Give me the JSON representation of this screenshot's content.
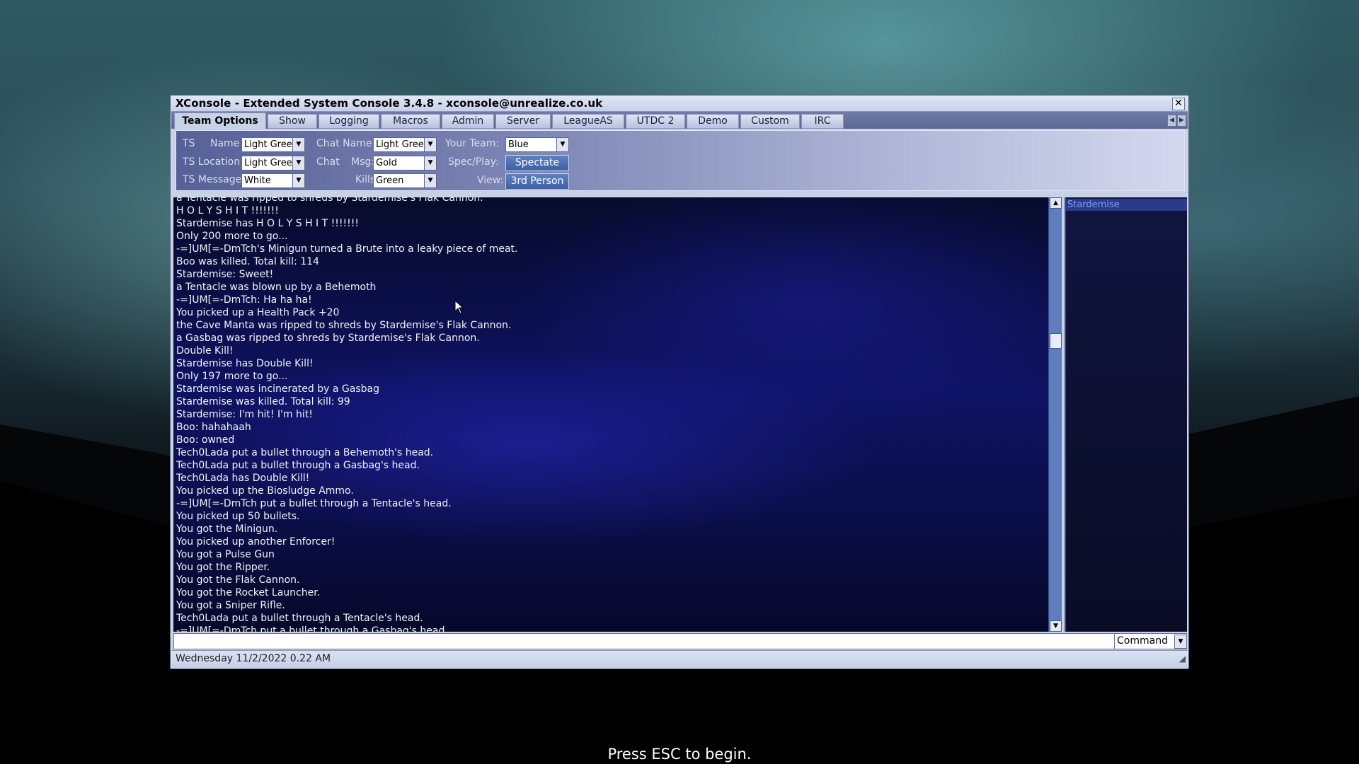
{
  "window": {
    "title": "XConsole - Extended System Console 3.4.8 - xconsole@unrealize.co.uk",
    "close_glyph": "✕"
  },
  "tabs": [
    {
      "label": "Team Options",
      "active": true
    },
    {
      "label": "Show"
    },
    {
      "label": "Logging"
    },
    {
      "label": "Macros"
    },
    {
      "label": "Admin"
    },
    {
      "label": "Server"
    },
    {
      "label": "LeagueAS"
    },
    {
      "label": "UTDC 2"
    },
    {
      "label": "Demo"
    },
    {
      "label": "Custom"
    },
    {
      "label": "IRC"
    }
  ],
  "options": {
    "ts_label": "TS",
    "name_label": "Name",
    "name_value": "Light Green",
    "ts_location_label": "TS Location:",
    "ts_location_value": "Light Green",
    "ts_message_label": "TS Message:",
    "ts_message_value": "White",
    "chat_name_label": "Chat Name:",
    "chat_name_value": "Light Green",
    "chat_label": "Chat",
    "msg_label": "Msg:",
    "msg_value": "Gold",
    "kills_label": "Kills",
    "kills_value": "Green",
    "your_team_label": "Your Team:",
    "your_team_value": "Blue",
    "spec_play_label": "Spec/Play:",
    "spectate_button": "Spectate",
    "view_label": "View:",
    "view_button": "3rd Person"
  },
  "log": {
    "partial_top": "a Tentacle was ripped to shreds by Stardemise's Flak Cannon.",
    "lines": [
      "H O L Y   S H I T !!!!!!!",
      "Stardemise has H O L Y   S H I T !!!!!!!",
      "Only 200 more to go...",
      "-=]UM[=-DmTch's Minigun turned a Brute into a leaky piece of meat.",
      "Boo was killed. Total kill:  114",
      "Stardemise: Sweet!",
      "a Tentacle was blown up by a Behemoth",
      "-=]UM[=-DmTch: Ha ha ha!",
      "You picked up a Health Pack +20",
      "the Cave Manta was ripped to shreds by Stardemise's Flak Cannon.",
      "a Gasbag was ripped to shreds by Stardemise's Flak Cannon.",
      "Double Kill!",
      "Stardemise has Double Kill!",
      "Only 197 more to go...",
      "Stardemise was incinerated by a Gasbag",
      "Stardemise was killed. Total kill:  99",
      "Stardemise: I'm hit! I'm hit!",
      "Boo: hahahaah",
      "Boo: owned",
      "Tech0Lada put a bullet through a Behemoth's head.",
      "Tech0Lada put a bullet through a Gasbag's head.",
      "Tech0Lada has Double Kill!",
      "You picked up the Biosludge Ammo.",
      "-=]UM[=-DmTch put a bullet through a Tentacle's head.",
      "You picked up 50 bullets.",
      "You got the Minigun.",
      "You picked up another Enforcer!",
      "You got a Pulse Gun",
      "You got the Ripper.",
      "You got the Flak Cannon.",
      "You got the Rocket Launcher.",
      "You got a Sniper Rifle.",
      "Tech0Lada put a bullet through a Tentacle's head.",
      "-=]UM[=-DmTch put a bullet through a Gasbag's head."
    ]
  },
  "players": [
    "Stardemise"
  ],
  "command": {
    "input_value": "",
    "mode": "Command"
  },
  "status": {
    "datetime": "Wednesday 11/2/2022 0.22 AM"
  },
  "prompt": "Press ESC to begin.",
  "colors": {
    "log_text": "#f2f2f6",
    "player_highlight": "#74a6ff",
    "accent": "#3d5fa6"
  }
}
